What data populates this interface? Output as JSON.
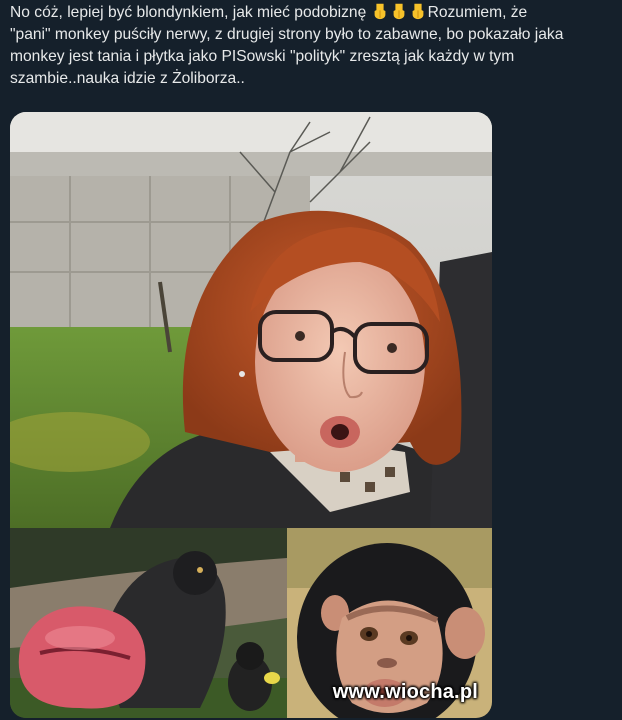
{
  "tweet": {
    "line1_a": "No cóż, lepiej być blondynkiem, jak mieć podobiznę ",
    "line1_b": "Rozumiem, że",
    "line2": "\"pani\" monkey puściły nerwy, z drugiej strony było to zabawne, bo pokazało jaka",
    "line3": "monkey jest tania i płytka jako PISowski \"polityk\" zresztą jak każdy w tym",
    "line4": "szambie..nauka idzie z Żoliborza..",
    "emojis": [
      "pointing-down-hand",
      "pointing-down-hand",
      "pointing-down-hand"
    ]
  },
  "media": {
    "photos": [
      "woman-selfie-photo",
      "macaque-photo",
      "chimpanzee-photo"
    ]
  },
  "watermark": "www.wiocha.pl",
  "colors": {
    "background": "#15202b",
    "text": "#e7e9ea",
    "emoji": "#f7c22a"
  }
}
